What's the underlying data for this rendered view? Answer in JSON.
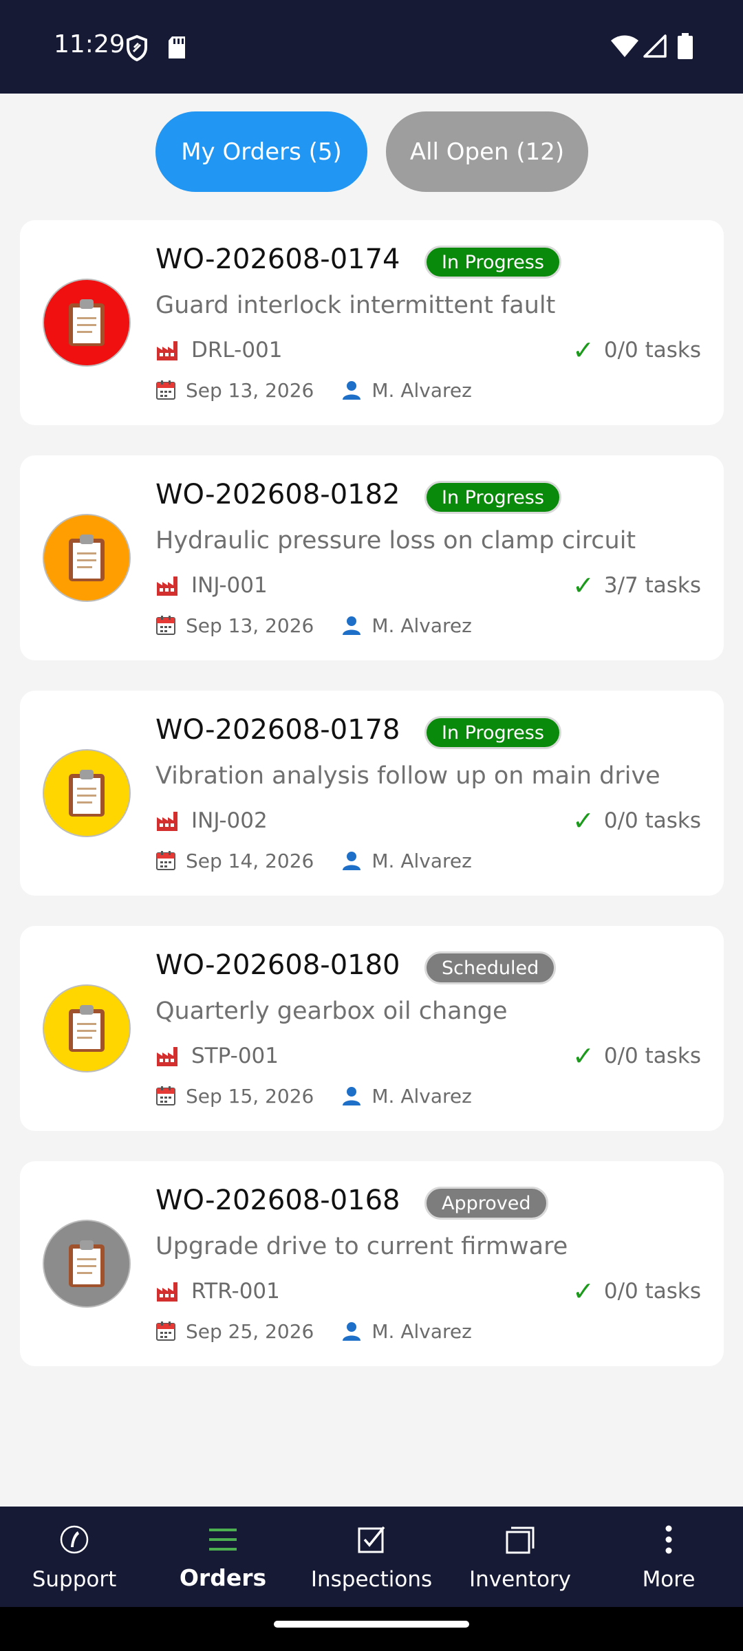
{
  "status_bar": {
    "time": "11:29"
  },
  "tabs": {
    "my_orders": "My Orders (5)",
    "all_open": "All Open (12)"
  },
  "orders": [
    {
      "number": "WO-202608-0174",
      "status": "In Progress",
      "status_color": "#0a8a0a",
      "priority_color": "#f01010",
      "title": "Guard interlock intermittent fault",
      "asset": "DRL-001",
      "tasks": "0/0 tasks",
      "date": "Sep 13, 2026",
      "assignee": "M. Alvarez"
    },
    {
      "number": "WO-202608-0182",
      "status": "In Progress",
      "status_color": "#0a8a0a",
      "priority_color": "#ff9e00",
      "title": "Hydraulic pressure loss on clamp circuit",
      "asset": "INJ-001",
      "tasks": "3/7 tasks",
      "date": "Sep 13, 2026",
      "assignee": "M. Alvarez"
    },
    {
      "number": "WO-202608-0178",
      "status": "In Progress",
      "status_color": "#0a8a0a",
      "priority_color": "#ffd600",
      "title": "Vibration analysis follow up on main drive",
      "asset": "INJ-002",
      "tasks": "0/0 tasks",
      "date": "Sep 14, 2026",
      "assignee": "M. Alvarez"
    },
    {
      "number": "WO-202608-0180",
      "status": "Scheduled",
      "status_color": "#7d7d7d",
      "priority_color": "#ffd600",
      "title": "Quarterly gearbox oil change",
      "asset": "STP-001",
      "tasks": "0/0 tasks",
      "date": "Sep 15, 2026",
      "assignee": "M. Alvarez"
    },
    {
      "number": "WO-202608-0168",
      "status": "Approved",
      "status_color": "#7d7d7d",
      "priority_color": "#8c8c8c",
      "title": "Upgrade drive to current firmware",
      "asset": "RTR-001",
      "tasks": "0/0 tasks",
      "date": "Sep 25, 2026",
      "assignee": "M. Alvarez"
    }
  ],
  "nav": [
    {
      "label": "Support",
      "icon": "phone-icon"
    },
    {
      "label": "Orders",
      "icon": "list-icon",
      "active": true
    },
    {
      "label": "Inspections",
      "icon": "checkbox-icon"
    },
    {
      "label": "Inventory",
      "icon": "box-icon"
    },
    {
      "label": "More",
      "icon": "more-vertical-icon"
    }
  ]
}
